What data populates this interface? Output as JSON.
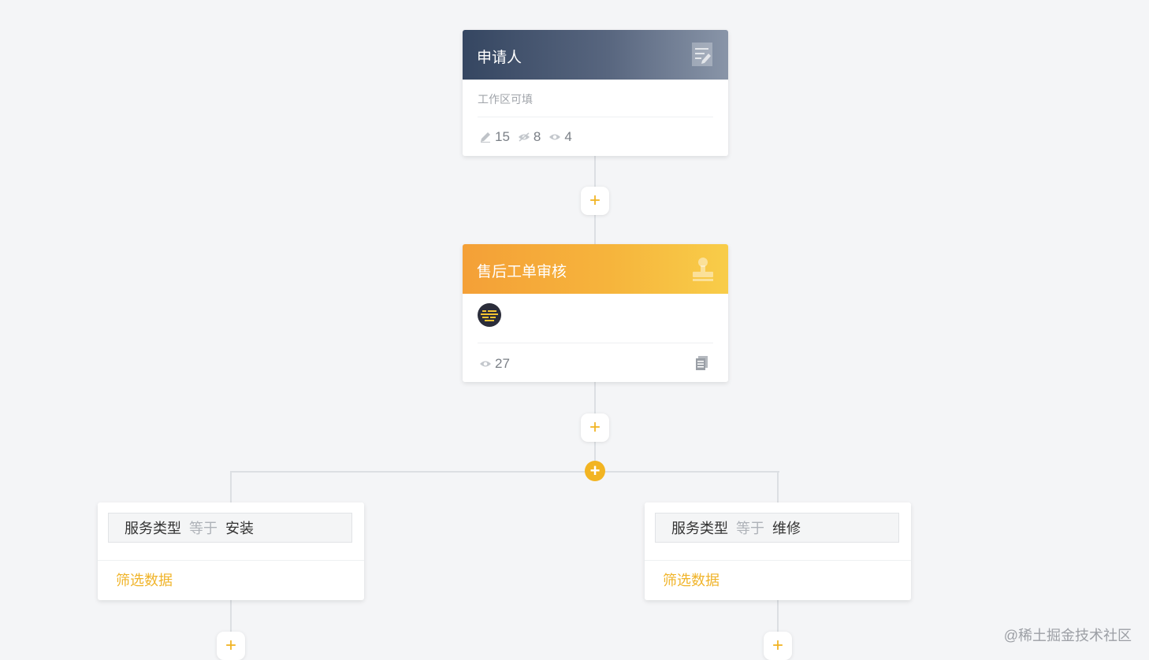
{
  "node_applicant": {
    "title": "申请人",
    "subtitle": "工作区可填",
    "stats": {
      "edit_count": "15",
      "readonly_count": "8",
      "view_count": "4"
    }
  },
  "node_approval": {
    "title": "售后工单审核",
    "stats": {
      "view_count": "27"
    }
  },
  "add_button_symbol": "+",
  "add_branch_symbol": "+",
  "branches": [
    {
      "field": "服务类型",
      "operator": "等于",
      "value": "安装",
      "link": "筛选数据"
    },
    {
      "field": "服务类型",
      "operator": "等于",
      "value": "维修",
      "link": "筛选数据"
    }
  ],
  "watermark": "@稀土掘金技术社区",
  "colors": {
    "accent": "#f2b422",
    "applicant_header": "#354661",
    "approval_header": "#f4a037",
    "background": "#f4f5f7"
  },
  "icons": {
    "applicant_header": "form-edit-icon",
    "approval_header": "stamp-icon",
    "edit": "pencil-icon",
    "readonly": "eye-slash-icon",
    "view": "eye-icon",
    "document": "document-icon"
  }
}
